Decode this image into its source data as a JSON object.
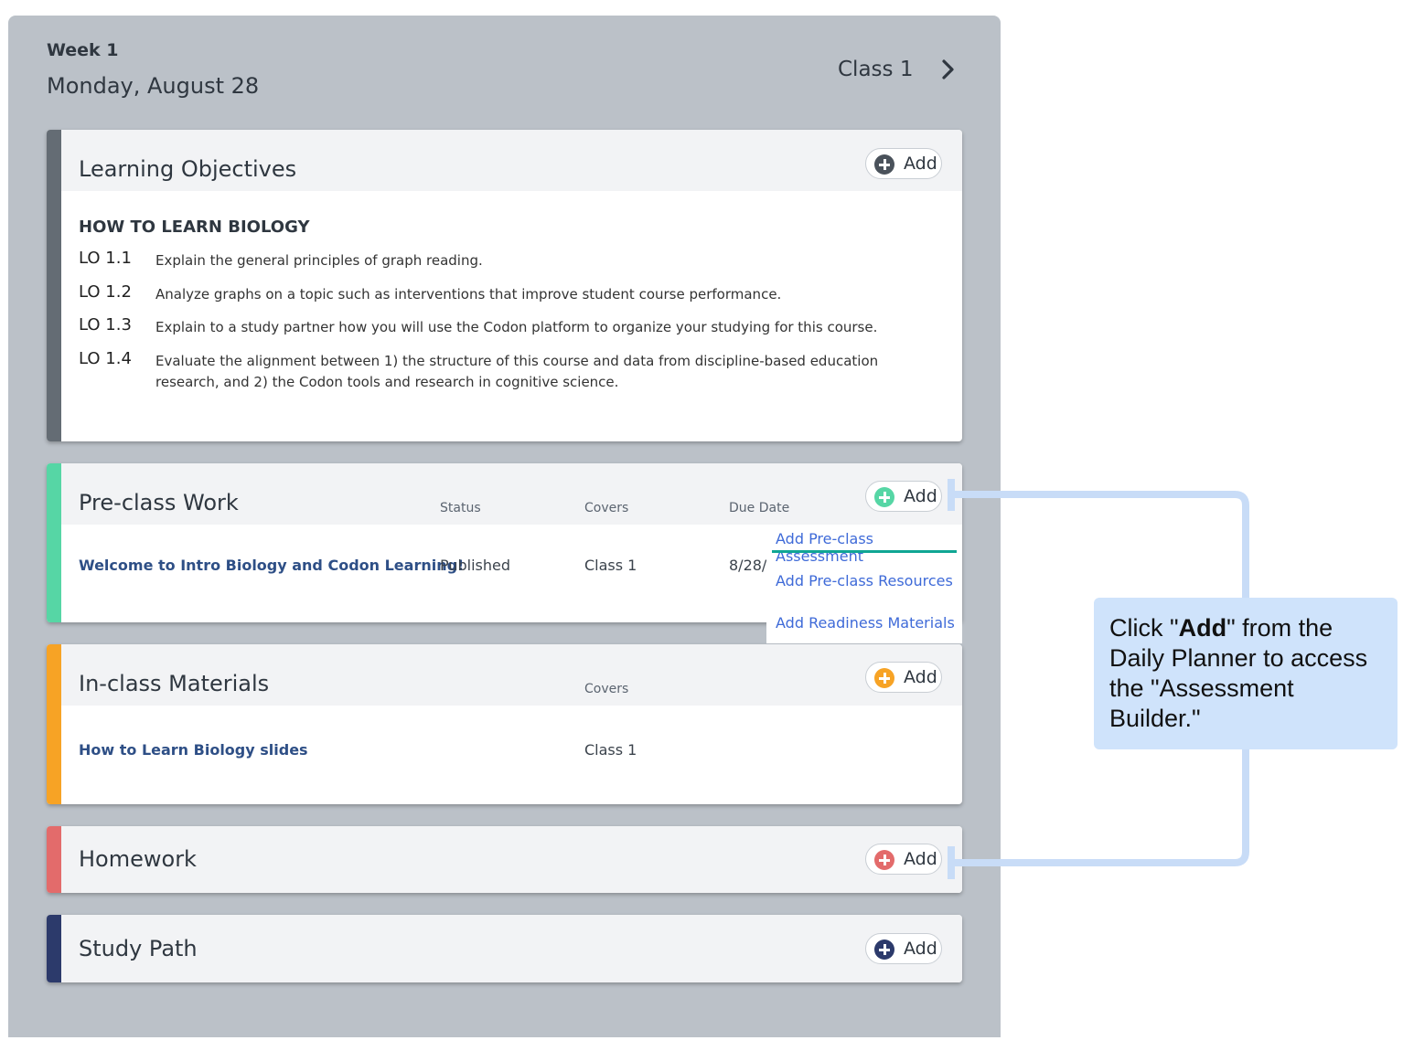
{
  "header": {
    "week": "Week 1",
    "date": "Monday, August 28",
    "class_label": "Class 1"
  },
  "colors": {
    "panel_bg": "#bbc1c8",
    "learning_objectives": "#646c74",
    "preclass": "#56d6a5",
    "inclass": "#f7a325",
    "homework": "#e36b6b",
    "study_path": "#2c3a6b",
    "link_blue": "#3e6ad8",
    "underline_teal": "#10a694",
    "callout_bg": "#cfe3fb"
  },
  "learning_objectives": {
    "title": "Learning Objectives",
    "add_label": "Add",
    "heading": "HOW TO LEARN BIOLOGY",
    "items": [
      {
        "code": "LO 1.1",
        "text": "Explain the general principles of graph reading."
      },
      {
        "code": "LO 1.2",
        "text": "Analyze graphs on a topic such as interventions that improve student course performance."
      },
      {
        "code": "LO 1.3",
        "text": "Explain to a study partner how you will use the Codon platform to organize your studying for this course."
      },
      {
        "code": "LO 1.4",
        "text": "Evaluate the alignment between 1) the structure of this course and data from discipline-based education research, and 2) the Codon tools and research in cognitive science."
      }
    ]
  },
  "preclass": {
    "title": "Pre-class Work",
    "add_label": "Add",
    "columns": {
      "status": "Status",
      "covers": "Covers",
      "due": "Due Date"
    },
    "rows": [
      {
        "name": "Welcome to Intro Biology and Codon Learning!",
        "status": "Published",
        "covers": "Class 1",
        "due": "8/28/..."
      }
    ]
  },
  "add_menu": {
    "items": [
      "Add Pre-class Assessment",
      "Add Pre-class Resources",
      "Add Readiness Materials"
    ]
  },
  "inclass": {
    "title": "In-class Materials",
    "add_label": "Add",
    "columns": {
      "covers": "Covers"
    },
    "rows": [
      {
        "name": "How to Learn Biology slides",
        "covers": "Class 1"
      }
    ]
  },
  "homework": {
    "title": "Homework",
    "add_label": "Add"
  },
  "study_path": {
    "title": "Study Path",
    "add_label": "Add"
  },
  "callout": {
    "prefix": "Click \"",
    "bold": "Add",
    "suffix": "\" from the Daily Planner to access the \"Assessment Builder.\""
  }
}
